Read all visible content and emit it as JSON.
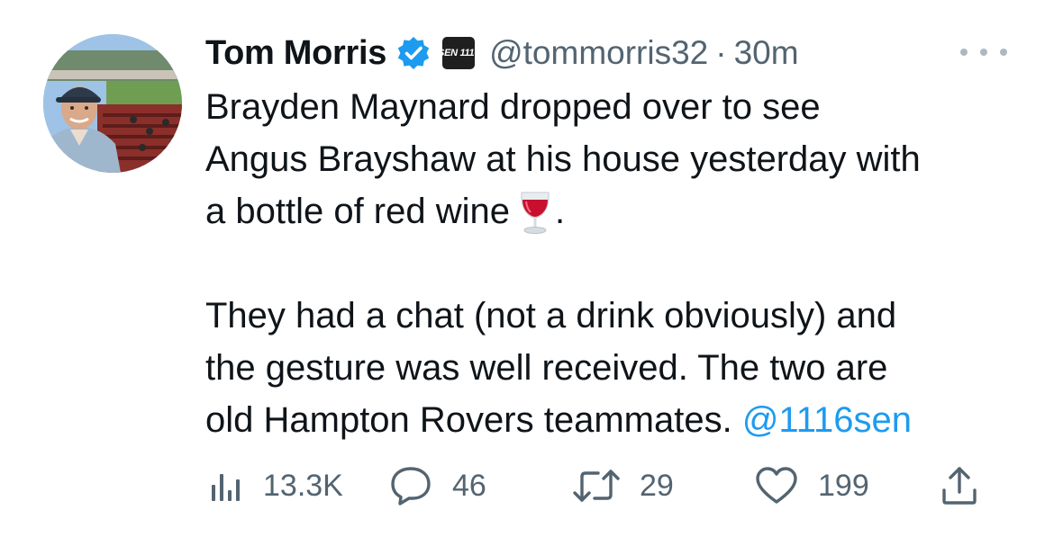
{
  "tweet": {
    "author": {
      "name": "Tom Morris",
      "handle": "@tommorris32",
      "separator": "·",
      "time": "30m",
      "affiliation_badge": "SEN 1116",
      "verified_color": "#1d9bf0"
    },
    "body": {
      "line1": "Brayden Maynard dropped over to see",
      "line2": "Angus Brayshaw at his house yesterday with",
      "line3_text": "a bottle of red wine",
      "line3_end": ".",
      "line4": "They had a chat (not a drink obviously) and",
      "line5": "the gesture was well received. The two are",
      "line6_text": "old Hampton Rovers teammates.",
      "mention": "@1116sen"
    },
    "actions": {
      "views": "13.3K",
      "replies": "46",
      "retweets": "29",
      "likes": "199"
    },
    "icons": [
      "verified-badge-icon",
      "wine-glass-emoji",
      "more-options-icon",
      "views-icon",
      "reply-icon",
      "retweet-icon",
      "like-icon",
      "share-icon"
    ],
    "colors": {
      "text": "#0f1419",
      "secondary": "#536471",
      "link": "#1d9bf0"
    }
  }
}
